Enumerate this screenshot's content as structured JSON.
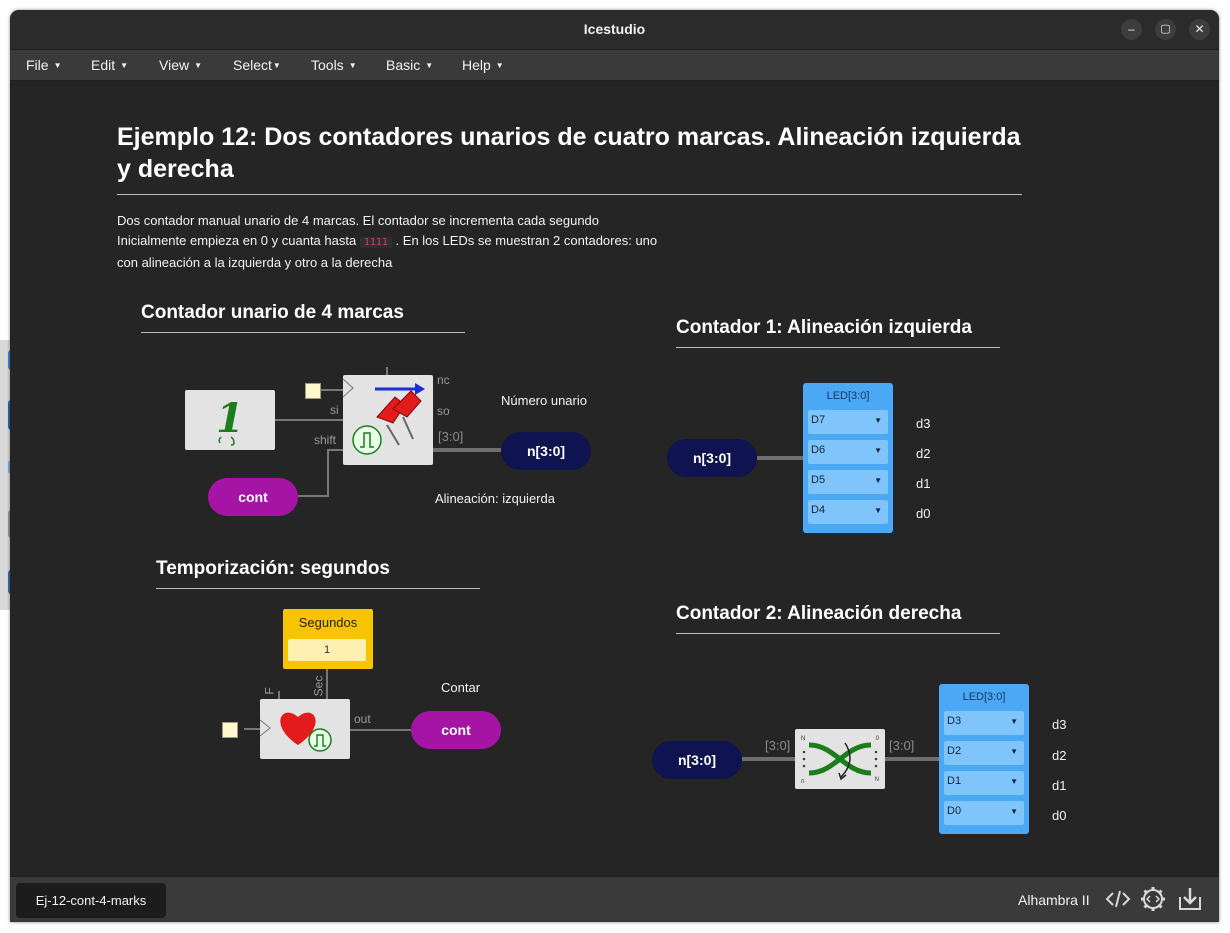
{
  "window": {
    "title": "Icestudio",
    "controls": {
      "minimize": "–",
      "maximize": "▢",
      "close": "✕"
    }
  },
  "menubar": {
    "items": [
      {
        "label": "File"
      },
      {
        "label": "Edit"
      },
      {
        "label": "View"
      },
      {
        "label": "Select"
      },
      {
        "label": "Tools"
      },
      {
        "label": "Basic"
      },
      {
        "label": "Help"
      }
    ]
  },
  "canvas": {
    "heading": "Ejemplo 12: Dos contadores unarios de cuatro marcas. Alineación izquierda y derecha",
    "description": {
      "line1": "Dos contador manual unario de 4 marcas. El contador se incrementa cada segundo",
      "line2_before": "Inicialmente empieza en 0 y cuanta hasta",
      "line2_code": "1111",
      "line2_after": ". En los LEDs se muestran 2 contadores: uno",
      "line3": "con alineación a la izquierda y otro a la derecha"
    },
    "sections": {
      "counter": "Contador unario de 4 marcas",
      "timing": "Temporización: segundos",
      "counter1": "Contador 1: Alineación izquierda",
      "counter2": "Contador 2: Alineación derecha"
    },
    "counter_module": {
      "numero_unario_label": "Número unario",
      "alineacion_label": "Alineación: izquierda",
      "one_glyph": "1",
      "ports": {
        "nc": "nc",
        "so": "so",
        "si": "si",
        "shift": "shift",
        "out_bus": "[3:0]"
      },
      "cont_input": "cont",
      "n_output": "n[3:0]"
    },
    "timer_module": {
      "param_title": "Segundos",
      "param_value": "1",
      "ports": {
        "F": "F",
        "Sec": "Sec",
        "out": "out"
      },
      "contar_label": "Contar",
      "cont_output": "cont"
    },
    "counter1_module": {
      "n_input": "n[3:0]",
      "led_title": "LED[3:0]",
      "leds": [
        {
          "pin": "D7",
          "name": "d3"
        },
        {
          "pin": "D6",
          "name": "d2"
        },
        {
          "pin": "D5",
          "name": "d1"
        },
        {
          "pin": "D4",
          "name": "d0"
        }
      ]
    },
    "counter2_module": {
      "n_input": "n[3:0]",
      "bus_in": "[3:0]",
      "bus_out": "[3:0]",
      "reverse_labels": {
        "n_top": "N",
        "zero_top": "0",
        "zero_bottom": "0",
        "n_bottom": "N"
      },
      "led_title": "LED[3:0]",
      "leds": [
        {
          "pin": "D3",
          "name": "d3"
        },
        {
          "pin": "D2",
          "name": "d2"
        },
        {
          "pin": "D1",
          "name": "d1"
        },
        {
          "pin": "D0",
          "name": "d0"
        }
      ]
    }
  },
  "bottombar": {
    "file_tab": "Ej-12-cont-4-marks",
    "board": "Alhambra II",
    "icons": [
      "code-icon",
      "settings-code-icon",
      "download-icon"
    ]
  }
}
